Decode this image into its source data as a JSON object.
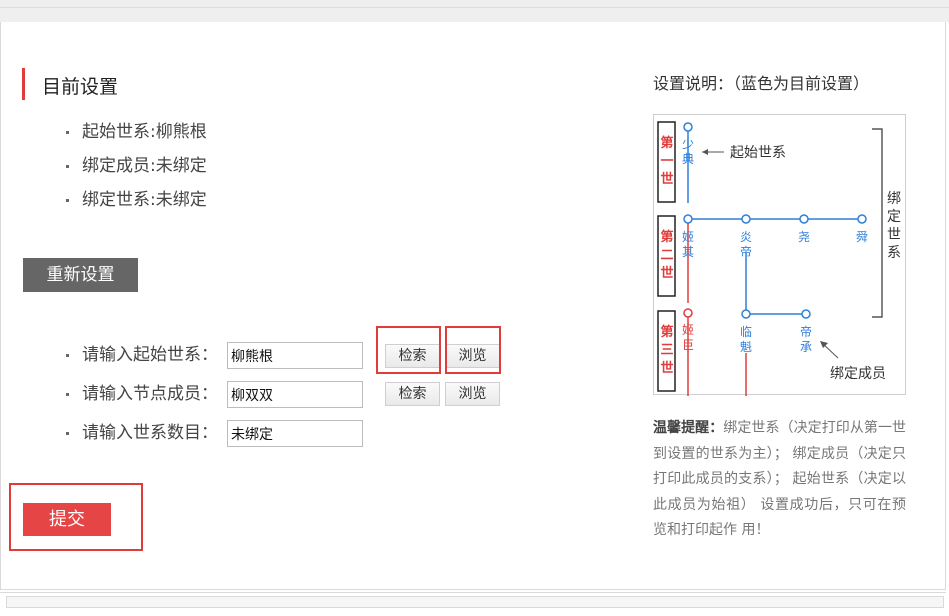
{
  "current": {
    "title": "目前设置",
    "items": [
      "起始世系:柳熊根",
      "绑定成员:未绑定",
      "绑定世系:未绑定"
    ]
  },
  "reset_label": "重新设置",
  "form": {
    "rows": [
      {
        "label": "请输入起始世系：",
        "value": "柳熊根"
      },
      {
        "label": "请输入节点成员：",
        "value": "柳双双"
      },
      {
        "label": "请输入世系数目：",
        "value": "未绑定"
      }
    ],
    "search_label": "检索",
    "browse_label": "浏览"
  },
  "submit_label": "提交",
  "description": {
    "title": "设置说明：（蓝色为目前设置）",
    "generations": [
      "第一世",
      "第二世",
      "第三世"
    ],
    "nodes": {
      "shaodian": "少典",
      "jiqi": "姬其",
      "yandi": "炎帝",
      "yao": "尧",
      "shun": "舜",
      "jiju": "姬巨",
      "linkui": "临魁",
      "dicheng": "帝承"
    },
    "annotations": {
      "start": "起始世系",
      "bind_gen": "绑定世系",
      "bind_member": "绑定成员"
    }
  },
  "tip": {
    "strong": "温馨提醒：",
    "text": "绑定世系（决定打印从第一世到设置的世系为主）； 绑定成员（决定只打印此成员的支系）； 起始世系（决定以此成员为始祖） 设置成功后，只可在预览和打印起作 用！"
  },
  "colors": {
    "accent": "#e03c3c",
    "blue": "#2f7fd8",
    "submit": "#e54545",
    "reset": "#666666"
  }
}
